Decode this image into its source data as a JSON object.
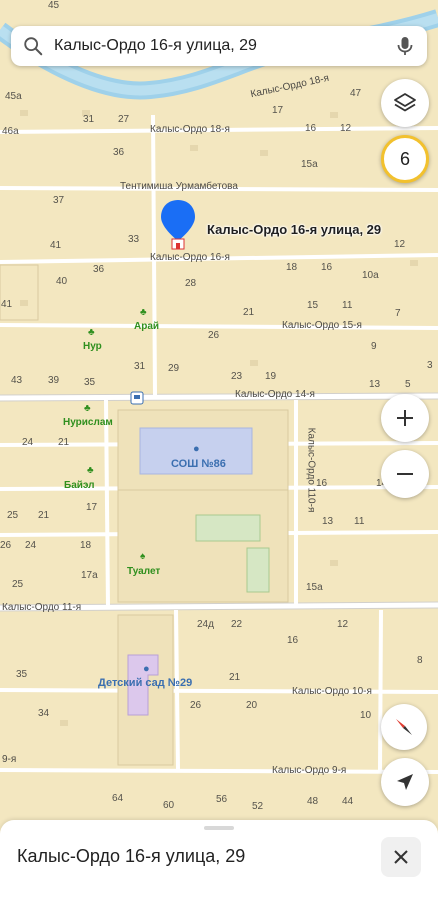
{
  "search": {
    "query": "Калыс-Ордо 16-я улица, 29"
  },
  "traffic": {
    "level": "6",
    "color": "#f2c12e"
  },
  "pin": {
    "label": "Калыс-Ордо 16-я улица, 29",
    "color": "#1a6ef5"
  },
  "map_labels": {
    "streets": {
      "s1": "Калыс-Ордо 18-я",
      "s2": "Калыс-Ордо 18-я",
      "s3": "Тентимиша Урмамбетова",
      "s4": "Калыс-Ордо 16-я",
      "s5": "Калыс-Ордо 15-я",
      "s6": "Калыс-Ордо 14-я",
      "s7": "Калыс-Ордо 110-я",
      "s8": "Калыс-Ордо 11-я",
      "s9": "Калыс-Ордо 10-я",
      "s10": "Калыс-Ордо 9-я",
      "s11": "9-я"
    },
    "pois": {
      "arai": "Арай",
      "nur": "Нур",
      "nurislam": "Нурислам",
      "baiel": "Байэл",
      "school": "СОШ №86",
      "toilet": "Туалет",
      "kindergarten": "Детский сад №29"
    },
    "houses": {
      "h1": "45а",
      "h2": "46а",
      "h3": "31",
      "h4": "27",
      "h5": "36",
      "h6": "37",
      "h7": "41",
      "h8": "33",
      "h9": "36",
      "h10": "40",
      "h11": "28",
      "h12": "41",
      "h13": "31",
      "h14": "29",
      "h15": "43",
      "h16": "39",
      "h17": "35",
      "h18": "26",
      "h19": "21",
      "h20": "23",
      "h21": "19",
      "h22": "24",
      "h23": "21",
      "h24": "17",
      "h25": "25",
      "h26": "21",
      "h27": "26",
      "h28": "24",
      "h29": "18",
      "h30": "17а",
      "h31": "25",
      "h32": "24д",
      "h33": "22",
      "h34": "16",
      "h35": "35",
      "h36": "21",
      "h37": "34",
      "h38": "26",
      "h39": "20",
      "h40": "64",
      "h41": "60",
      "h42": "56",
      "h43": "52",
      "h44": "48",
      "h45": "44",
      "h46": "17",
      "h47": "16",
      "h48": "12",
      "h49": "15а",
      "h50": "18",
      "h51": "16",
      "h52": "10а",
      "h53": "15",
      "h54": "11",
      "h55": "7",
      "h56": "13",
      "h57": "9",
      "h58": "5",
      "h59": "16",
      "h60": "14",
      "h61": "13",
      "h62": "11",
      "h63": "15а",
      "h64": "12",
      "h65": "8",
      "h66": "10",
      "h67": "47",
      "h68": "45",
      "h69": "3",
      "h70": "12"
    }
  },
  "sheet": {
    "title": "Калыс-Ордо 16-я улица, 29"
  }
}
